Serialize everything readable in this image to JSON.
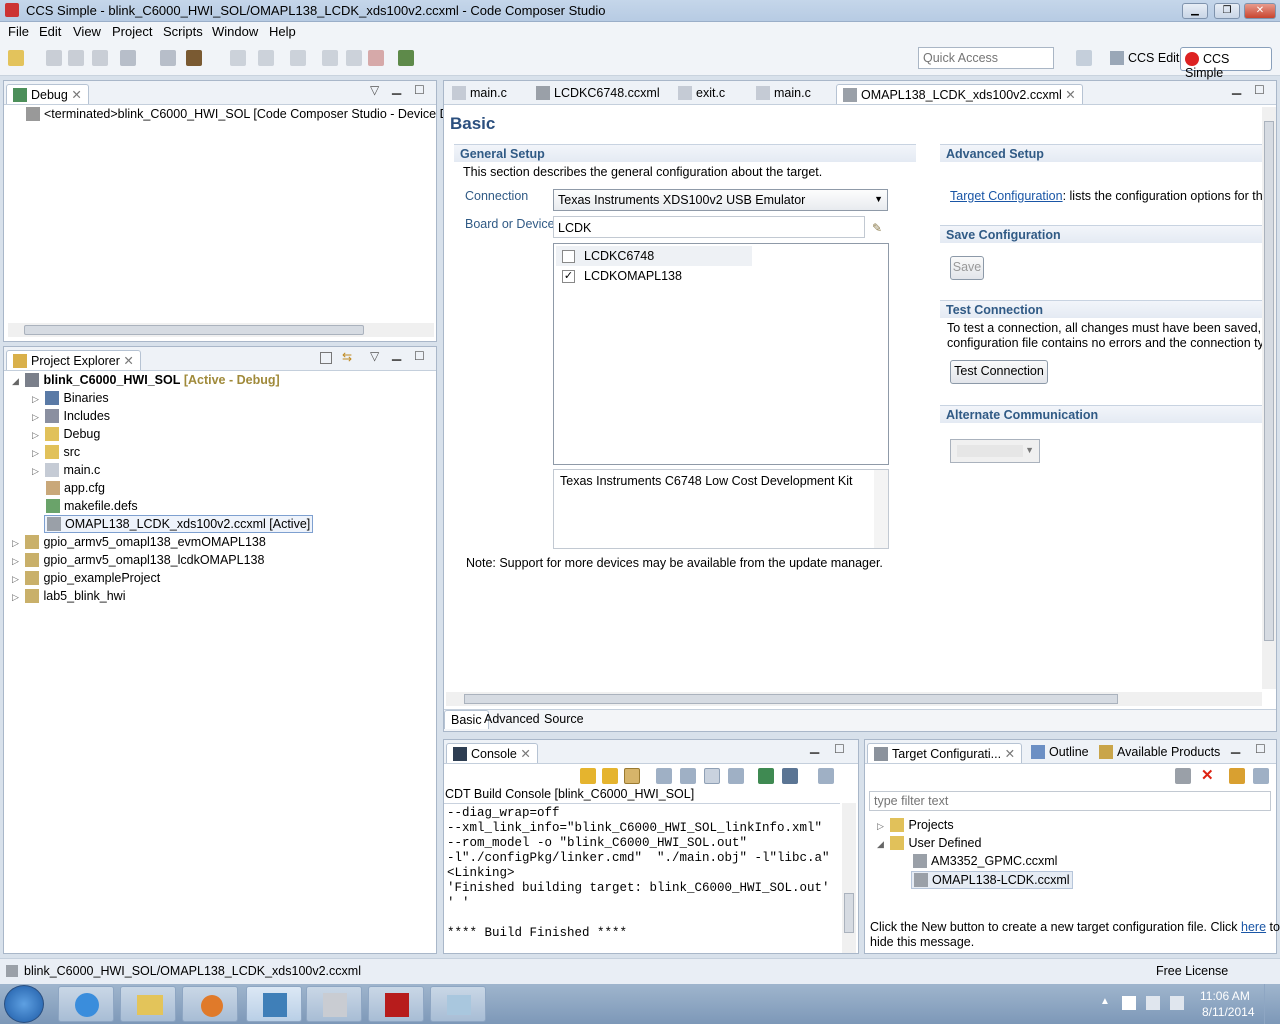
{
  "window": {
    "title": "CCS Simple - blink_C6000_HWI_SOL/OMAPL138_LCDK_xds100v2.ccxml - Code Composer Studio"
  },
  "menu": [
    "File",
    "Edit",
    "View",
    "Project",
    "Scripts",
    "Window",
    "Help"
  ],
  "toolbar": {
    "quick_access_placeholder": "Quick Access",
    "perspectives": [
      "CCS Edit",
      "CCS Simple"
    ]
  },
  "debug_view": {
    "tab": "Debug",
    "item": "<terminated>blink_C6000_HWI_SOL [Code Composer Studio - Device Deb"
  },
  "project_explorer": {
    "tab": "Project Explorer",
    "root": {
      "name": "blink_C6000_HWI_SOL",
      "tag": "[Active - Debug]"
    },
    "children": [
      "Binaries",
      "Includes",
      "Debug",
      "src",
      "main.c",
      "app.cfg",
      "makefile.defs",
      "OMAPL138_LCDK_xds100v2.ccxml [Active]"
    ],
    "others": [
      "gpio_armv5_omapl138_evmOMAPL138",
      "gpio_armv5_omapl138_lcdkOMAPL138",
      "gpio_exampleProject",
      "lab5_blink_hwi"
    ]
  },
  "editor": {
    "tabs": [
      "main.c",
      "LCDKC6748.ccxml",
      "exit.c",
      "main.c",
      "OMAPL138_LCDK_xds100v2.ccxml"
    ],
    "heading": "Basic",
    "general_setup": {
      "title": "General Setup",
      "desc": "This section describes the general configuration about the target.",
      "connection_label": "Connection",
      "connection_value": "Texas Instruments XDS100v2 USB Emulator",
      "board_label": "Board or Device",
      "board_value": "LCDK",
      "devices": [
        {
          "name": "LCDKC6748",
          "checked": false
        },
        {
          "name": "LCDKOMAPL138",
          "checked": true
        }
      ],
      "description": "Texas Instruments C6748 Low Cost Development Kit",
      "note": "Note: Support for more devices may be available from the update manager."
    },
    "advanced_setup": {
      "title": "Advanced Setup",
      "link": "Target Configuration",
      "text": ": lists the configuration options for th"
    },
    "save_config": {
      "title": "Save Configuration",
      "button": "Save"
    },
    "test_connection": {
      "title": "Test Connection",
      "text1": "To test a connection, all changes must have been saved, the",
      "text2": "configuration file contains no errors and the connection typ",
      "button": "Test Connection"
    },
    "alt_comm": {
      "title": "Alternate Communication"
    },
    "bottom_tabs": [
      "Basic",
      "Advanced",
      "Source"
    ]
  },
  "console": {
    "tab": "Console",
    "header": "CDT Build Console [blink_C6000_HWI_SOL]",
    "lines": [
      "--diag_wrap=off",
      "--xml_link_info=\"blink_C6000_HWI_SOL_linkInfo.xml\"",
      "--rom_model -o \"blink_C6000_HWI_SOL.out\"",
      "-l\"./configPkg/linker.cmd\"  \"./main.obj\" -l\"libc.a\"",
      "<Linking>",
      "'Finished building target: blink_C6000_HWI_SOL.out'",
      "' '",
      "",
      "**** Build Finished ****"
    ]
  },
  "target_config": {
    "tabs": [
      "Target Configurati...",
      "Outline",
      "Available Products"
    ],
    "filter_placeholder": "type filter text",
    "tree": {
      "projects": "Projects",
      "user_defined": "User Defined",
      "files": [
        "AM3352_GPMC.ccxml",
        "OMAPL138-LCDK.ccxml"
      ]
    },
    "hint": "Click the New button to create a new target configuration file. Click",
    "hint_link": "here",
    "hint_end": "to",
    "hint2": "hide this message."
  },
  "statusbar": {
    "path": "blink_C6000_HWI_SOL/OMAPL138_LCDK_xds100v2.ccxml",
    "license": "Free License"
  },
  "taskbar": {
    "time": "11:06 AM",
    "date": "8/11/2014"
  }
}
